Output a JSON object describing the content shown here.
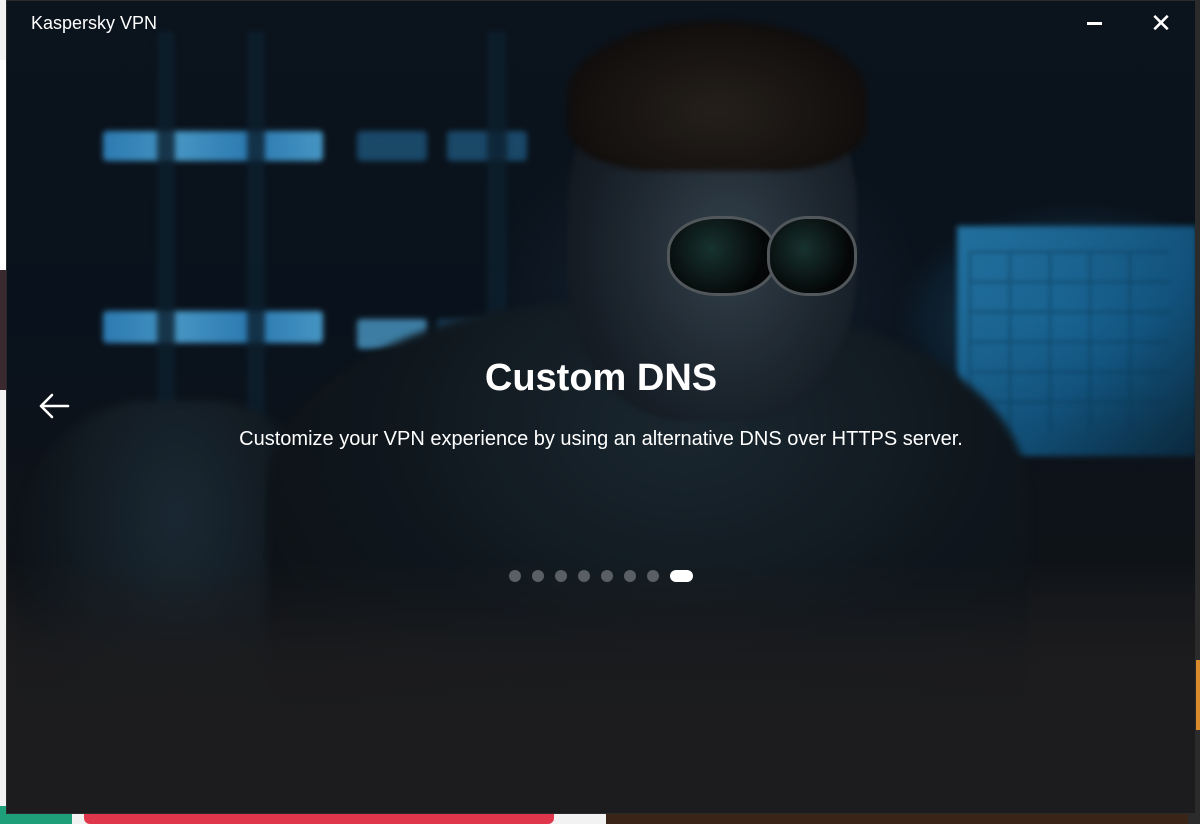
{
  "window": {
    "title": "Kaspersky VPN",
    "minimize_icon": "minimize-icon",
    "close_icon": "close-icon",
    "close_glyph": "✕"
  },
  "slide": {
    "title": "Custom DNS",
    "description": "Customize your VPN experience by using an alternative DNS over HTTPS server.",
    "back_icon": "arrow-left-icon"
  },
  "pagination": {
    "total": 8,
    "active_index": 7
  },
  "colors": {
    "window_bg": "#1c1c1e",
    "accent_screen": "#2f9ad8",
    "dot_inactive": "#5a5f66",
    "dot_active": "#ffffff"
  }
}
